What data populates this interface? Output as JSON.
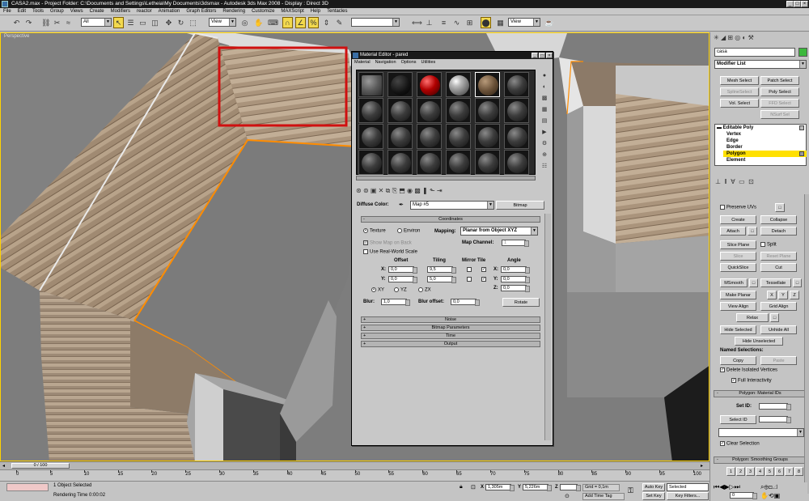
{
  "window": {
    "title": "CASA2.max - Project Folder: C:\\Documents and Settings\\Letheia\\My Documents\\3dsmax - Autodesk 3ds Max 2008 - Display : Direct 3D"
  },
  "menu": [
    "File",
    "Edit",
    "Tools",
    "Group",
    "Views",
    "Create",
    "Modifiers",
    "reactor",
    "Animation",
    "Graph Editors",
    "Rendering",
    "Customize",
    "MAXScript",
    "Help",
    "Tentacles"
  ],
  "toolbar": {
    "selection_filter": "All",
    "reference_coord": "View",
    "view_combo": "View"
  },
  "viewport": {
    "label": "Perspective"
  },
  "material_editor": {
    "title": "Material Editor - pared",
    "menu": [
      "Material",
      "Navigation",
      "Options",
      "Utilities"
    ],
    "diffuse_label": "Diffuse Color:",
    "map_name": "Map #5",
    "map_type": "Bitmap",
    "coordinates": {
      "header": "Coordinates",
      "texture": "Texture",
      "environ": "Environ",
      "mapping_label": "Mapping:",
      "mapping_value": "Planar from Object XYZ",
      "show_map_on_back": "Show Map on Back",
      "map_channel_label": "Map Channel:",
      "map_channel": "1",
      "use_real_world": "Use Real-World Scale",
      "offset": "Offset",
      "tiling": "Tiling",
      "mirror_tile": "Mirror Tile",
      "angle": "Angle",
      "u_label": "X:",
      "v_label": "Y:",
      "w_label": "Z:",
      "offset_u": "0,0",
      "offset_v": "0,0",
      "tiling_u": "9,5",
      "tiling_v": "5,0",
      "angle_u": "0,0",
      "angle_v": "0,0",
      "angle_w": "0,0",
      "xy": "XY",
      "yz": "YZ",
      "zx": "ZX",
      "blur_label": "Blur:",
      "blur": "1,0",
      "blur_offset_label": "Blur offset:",
      "blur_offset": "0,0",
      "rotate": "Rotate"
    },
    "rollouts": [
      "Noise",
      "Bitmap Parameters",
      "Time",
      "Output"
    ]
  },
  "command_panel": {
    "object_name": "casa",
    "modifier_list": "Modifier List",
    "mod_buttons": [
      "Mesh Select",
      "Patch Select",
      "SplineSelect",
      "Poly Select",
      "Vol. Select",
      "FFD Select",
      "NSurf Sel"
    ],
    "stack": [
      "Editable Poly",
      "Vertex",
      "Edge",
      "Border",
      "Polygon",
      "Element"
    ],
    "edit_geometry": {
      "preserve_uvs": "Preserve UVs",
      "create": "Create",
      "collapse": "Collapse",
      "attach": "Attach",
      "detach": "Detach",
      "slice_plane": "Slice Plane",
      "split": "Split",
      "slice": "Slice",
      "reset_plane": "Reset Plane",
      "quickslice": "QuickSlice",
      "cut": "Cut",
      "msmooth": "MSmooth",
      "tessellate": "Tessellate",
      "make_planar": "Make Planar",
      "x": "X",
      "y": "Y",
      "z": "Z",
      "view_align": "View Align",
      "grid_align": "Grid Align",
      "relax": "Relax",
      "hide_selected": "Hide Selected",
      "unhide_all": "Unhide All",
      "hide_unselected": "Hide Unselected",
      "named_selections": "Named Selections:",
      "copy": "Copy",
      "paste": "Paste",
      "delete_isolated": "Delete Isolated Vertices",
      "full_interactivity": "Full Interactivity"
    },
    "material_ids": {
      "header": "Polygon: Material IDs",
      "set_id": "Set ID:",
      "select_id": "Select ID",
      "clear_selection": "Clear Selection"
    },
    "smoothing": {
      "header": "Polygon: Smoothing Groups",
      "groups": [
        "1",
        "2",
        "3",
        "4",
        "5",
        "6",
        "7",
        "8"
      ]
    }
  },
  "timeline": {
    "frame": "0 / 100",
    "ticks": [
      "0",
      "5",
      "10",
      "15",
      "20",
      "25",
      "30",
      "35",
      "40",
      "45",
      "50",
      "55",
      "60",
      "65",
      "70",
      "75",
      "80",
      "85",
      "90",
      "95",
      "100"
    ]
  },
  "status": {
    "selection": "1 Object Selected",
    "render_time": "Rendering Time  0:00:02",
    "x_label": "X",
    "x_value": "1,305m",
    "y_label": "Y",
    "y_value": "5,226m",
    "z_label": "Z",
    "grid": "Grid = 0,1m",
    "add_time_tag": "Add Time Tag",
    "auto_key": "Auto Key",
    "selected": "Selected",
    "set_key": "Set Key",
    "key_filters": "Key Filters...",
    "frame_field": "0"
  },
  "colors": {
    "selection_box": "#d01010",
    "viewport_border": "#ffd200",
    "stack_highlight": "#ffe000",
    "active_tool": "#f2d94e"
  }
}
